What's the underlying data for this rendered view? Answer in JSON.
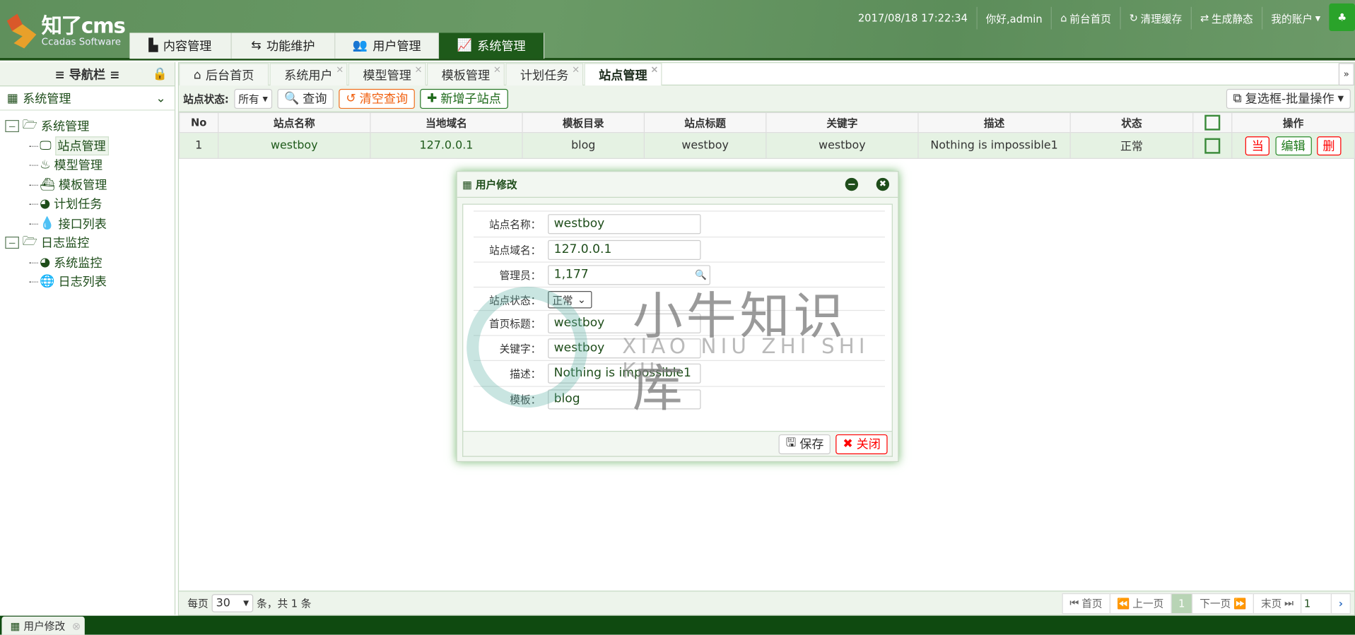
{
  "header": {
    "logo_text": "知了cms",
    "logo_sub": "Ccadas Software",
    "top_tabs": [
      {
        "label": "内容管理",
        "icon": "file-icon"
      },
      {
        "label": "功能维护",
        "icon": "retweet-icon"
      },
      {
        "label": "用户管理",
        "icon": "users-icon"
      },
      {
        "label": "系统管理",
        "icon": "line-chart-icon",
        "active": true
      }
    ],
    "datetime": "2017/08/18 17:22:34",
    "greeting": "你好,admin",
    "front_home": "前台首页",
    "clear_cache": "清理缓存",
    "gen_static": "生成静态",
    "my_account": "我的账户"
  },
  "sidebar": {
    "title": "≡ 导航栏 ≡",
    "module": "系统管理",
    "tree": [
      {
        "label": "系统管理",
        "children": [
          "站点管理",
          "模型管理",
          "模板管理",
          "计划任务",
          "接口列表"
        ]
      },
      {
        "label": "日志监控",
        "children": [
          "系统监控",
          "日志列表"
        ]
      }
    ]
  },
  "tabs": [
    {
      "label": "后台首页"
    },
    {
      "label": "系统用户"
    },
    {
      "label": "模型管理"
    },
    {
      "label": "模板管理"
    },
    {
      "label": "计划任务"
    },
    {
      "label": "站点管理",
      "active": true
    }
  ],
  "toolbar": {
    "status_label": "站点状态:",
    "status_value": "所有",
    "search": "查询",
    "clear": "清空查询",
    "add": "新增子站点",
    "batch": "复选框-批量操作"
  },
  "table": {
    "headers": [
      "No",
      "站点名称",
      "当地域名",
      "模板目录",
      "站点标题",
      "关键字",
      "描述",
      "状态",
      "",
      "操作"
    ],
    "rows": [
      {
        "no": "1",
        "name": "westboy",
        "domain": "127.0.0.1",
        "tpl": "blog",
        "title": "westboy",
        "keywords": "westboy",
        "desc": "Nothing is impossible1",
        "status": "正常"
      }
    ],
    "actions": [
      "当",
      "编辑",
      "删"
    ]
  },
  "pager": {
    "per_page_label": "每页",
    "per_page": "30",
    "total": "条，共 1 条",
    "first": "首页",
    "prev": "上一页",
    "current": "1",
    "next": "下一页",
    "last": "末页",
    "jump": "1"
  },
  "dialog": {
    "title": "用户修改",
    "fields": [
      {
        "label": "站点名称：",
        "value": "westboy"
      },
      {
        "label": "站点域名：",
        "value": "127.0.0.1"
      },
      {
        "label": "管理员：",
        "value": "1,177"
      },
      {
        "label": "站点状态：",
        "value": "正常"
      },
      {
        "label": "首页标题：",
        "value": "westboy"
      },
      {
        "label": "关键字：",
        "value": "westboy"
      },
      {
        "label": "描述：",
        "value": "Nothing is impossible1"
      },
      {
        "label": "模板：",
        "value": "blog"
      }
    ],
    "save": "保存",
    "close": "关闭"
  },
  "bottom_tab": "用户修改",
  "watermark": {
    "cn": "小牛知识库",
    "en": "XIAO NIU ZHI SHI KU"
  }
}
